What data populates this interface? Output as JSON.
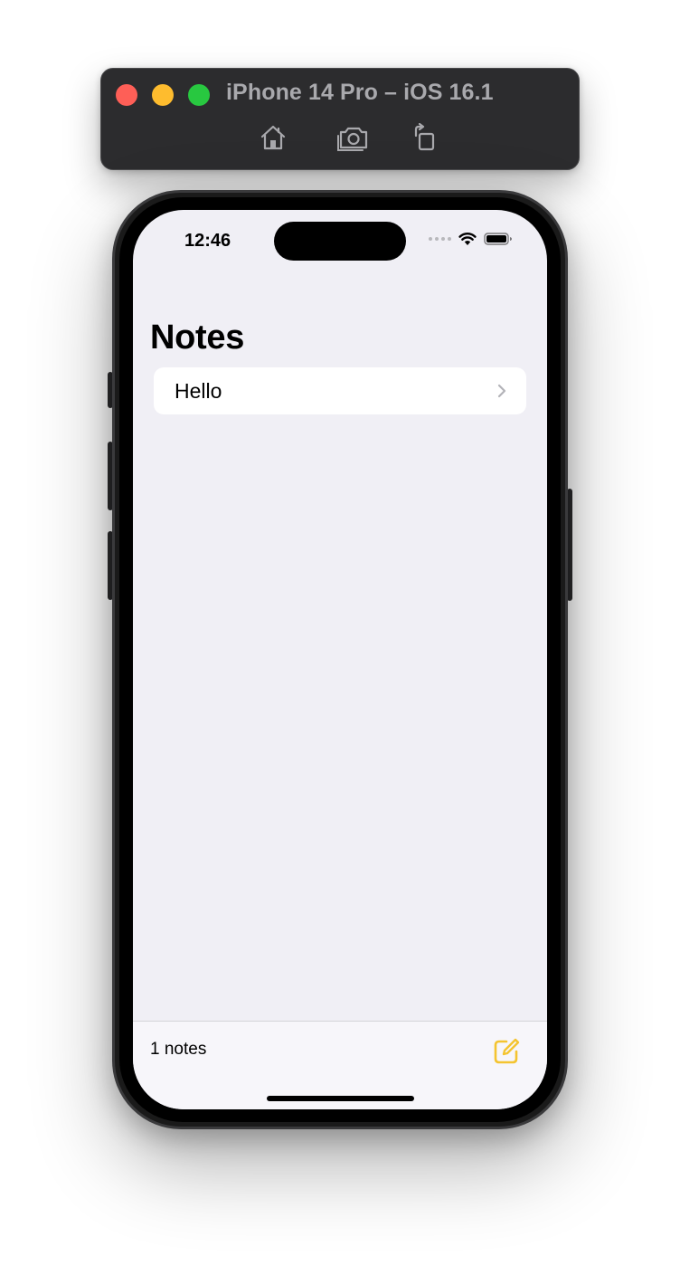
{
  "simulator": {
    "title": "iPhone 14 Pro – iOS 16.1",
    "controls": {
      "close": "close-button",
      "minimize": "minimize-button",
      "zoom": "zoom-button",
      "home_icon": "home-icon",
      "screenshot_icon": "camera-icon",
      "rotate_icon": "rotate-icon"
    },
    "colors": {
      "close": "#fe5f57",
      "minimize": "#febc2e",
      "zoom": "#28c840"
    }
  },
  "status_bar": {
    "time": "12:46",
    "icons": [
      "signal-dots-icon",
      "wifi-icon",
      "battery-icon"
    ]
  },
  "screen": {
    "large_title": "Notes",
    "notes": [
      {
        "title": "Hello"
      }
    ],
    "bottom_bar": {
      "count_label": "1 notes",
      "compose_icon": "compose-icon"
    },
    "colors": {
      "background": "#f0eff5",
      "accent": "#f4c430"
    }
  }
}
